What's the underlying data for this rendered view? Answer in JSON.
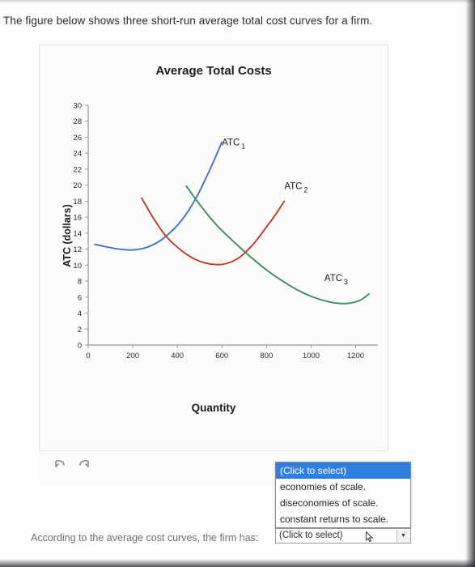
{
  "intro": {
    "text": "The figure below shows three short-run average total cost curves for a firm."
  },
  "chart_data": {
    "type": "line",
    "title": "Average Total Costs",
    "xlabel": "Quantity",
    "ylabel": "ATC (dollars)",
    "xlim": [
      0,
      1300
    ],
    "ylim": [
      0,
      30
    ],
    "xticks": [
      0,
      200,
      400,
      600,
      800,
      1000,
      1200
    ],
    "yticks": [
      0,
      2,
      4,
      6,
      8,
      10,
      12,
      14,
      16,
      18,
      20,
      22,
      24,
      26,
      28,
      30
    ],
    "grid": false,
    "legend": "inline-annotations",
    "series": [
      {
        "name": "ATC1",
        "label": "ATC",
        "subscript": "1",
        "color": "#4472c4",
        "label_x": 600,
        "label_y": 25,
        "x": [
          30,
          80,
          140,
          200,
          260,
          320,
          380,
          430,
          480,
          520,
          560,
          600
        ],
        "y": [
          12.6,
          12.3,
          12.0,
          11.9,
          12.2,
          13.0,
          14.4,
          16.0,
          18.2,
          20.4,
          22.8,
          25.4
        ]
      },
      {
        "name": "ATC2",
        "label": "ATC",
        "subscript": "2",
        "color": "#c0392b",
        "label_x": 880,
        "label_y": 19.5,
        "x": [
          240,
          290,
          350,
          420,
          490,
          560,
          620,
          680,
          740,
          790,
          840,
          880
        ],
        "y": [
          18.4,
          16.0,
          13.6,
          11.8,
          10.6,
          10.1,
          10.2,
          11.0,
          12.6,
          14.4,
          16.3,
          18.0
        ]
      },
      {
        "name": "ATC3",
        "label": "ATC",
        "subscript": "3",
        "color": "#3d8c5f",
        "label_x": 1060,
        "label_y": 8.0,
        "x": [
          440,
          500,
          570,
          650,
          730,
          810,
          890,
          960,
          1030,
          1100,
          1160,
          1220,
          1260
        ],
        "y": [
          19.9,
          17.6,
          15.2,
          13.0,
          11.0,
          9.2,
          7.7,
          6.6,
          5.8,
          5.3,
          5.2,
          5.6,
          6.4
        ]
      }
    ]
  },
  "toolbar": {
    "undo_icon": "undo-arrow-icon",
    "redo_icon": "redo-arrow-icon"
  },
  "bottom": {
    "question": "According to the average cost curves, the firm has:",
    "select_value": "(Click to select)",
    "select_arrow": "▼"
  },
  "dropdown": {
    "options": [
      "(Click to select)",
      "economies of scale.",
      "diseconomies of scale.",
      "constant returns to scale."
    ],
    "selected_index": 0
  }
}
